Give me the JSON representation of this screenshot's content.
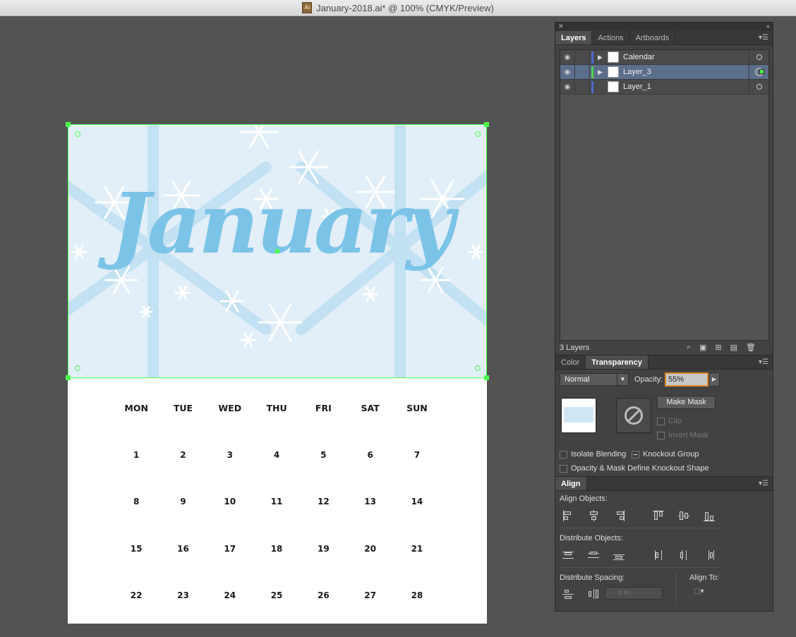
{
  "window": {
    "title": "January-2018.ai* @ 100% (CMYK/Preview)",
    "doc_icon_text": "Ai"
  },
  "artboard": {
    "month": "January",
    "weekdays": [
      "MON",
      "TUE",
      "WED",
      "THU",
      "FRI",
      "SAT",
      "SUN"
    ],
    "weeks": [
      [
        "1",
        "2",
        "3",
        "4",
        "5",
        "6",
        "7"
      ],
      [
        "8",
        "9",
        "10",
        "11",
        "12",
        "13",
        "14"
      ],
      [
        "15",
        "16",
        "17",
        "18",
        "19",
        "20",
        "21"
      ],
      [
        "22",
        "23",
        "24",
        "25",
        "26",
        "27",
        "28"
      ]
    ]
  },
  "layers_panel": {
    "tabs": [
      "Layers",
      "Actions",
      "Artboards"
    ],
    "active_tab": "Layers",
    "layers": [
      {
        "name": "Calendar",
        "color": "#4f6bd6",
        "expandable": true,
        "selected": false
      },
      {
        "name": "Layer_3",
        "color": "#4cd64c",
        "expandable": true,
        "selected": true
      },
      {
        "name": "Layer_1",
        "color": "#4f6bd6",
        "expandable": false,
        "selected": false
      }
    ],
    "count_label": "3 Layers"
  },
  "transparency_panel": {
    "tabs": [
      "Color",
      "Transparency"
    ],
    "active_tab": "Transparency",
    "blend_mode": "Normal",
    "opacity_label": "Opacity:",
    "opacity_value": "55%",
    "make_mask_label": "Make Mask",
    "clip_label": "Clip",
    "invert_mask_label": "Invert Mask",
    "isolate_blending_label": "Isolate Blending",
    "knockout_group_label": "Knockout Group",
    "opacity_mask_label": "Opacity & Mask Define Knockout Shape"
  },
  "align_panel": {
    "title": "Align",
    "align_objects_label": "Align Objects:",
    "distribute_objects_label": "Distribute Objects:",
    "distribute_spacing_label": "Distribute Spacing:",
    "align_to_label": "Align To:",
    "spacing_value": "0 in"
  }
}
